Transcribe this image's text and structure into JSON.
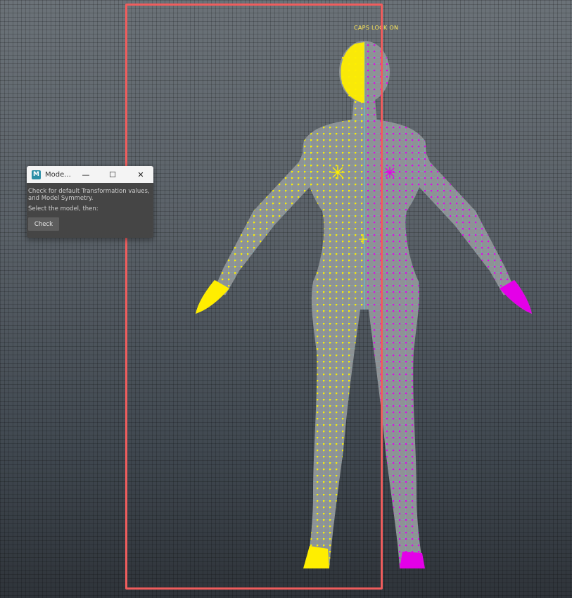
{
  "viewport": {
    "hud_caps_lock": "CAPS LOCK ON",
    "colors": {
      "grid_background": "#596067",
      "mesh_fill": "#8e9295",
      "wire": "#5ec8d8",
      "selected_vertices": "#ffee00",
      "symmetry_vertices": "#e400e8",
      "selection_outline": "#ef5d5d"
    }
  },
  "tool_window": {
    "title": "Mode...",
    "app_icon_letter": "M",
    "minimize_glyph": "—",
    "maximize_glyph": "☐",
    "close_glyph": "✕",
    "description_line1": "Check for default Transformation values,",
    "description_line2": "and Model Symmetry.",
    "instruction": "Select the model, then:",
    "check_button": "Check"
  }
}
